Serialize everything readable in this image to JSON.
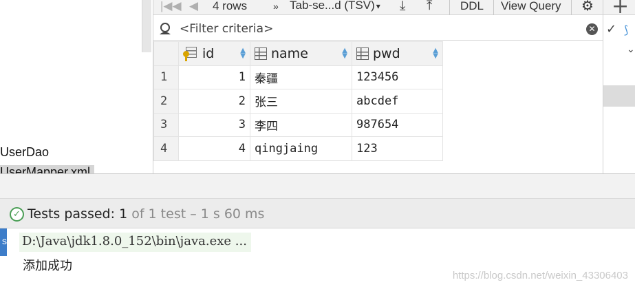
{
  "project_tree": {
    "item1": "UserDao",
    "item2": "UserMapper.xml"
  },
  "toolbar": {
    "rows_label": "4 rows",
    "format_label": "Tab-se...d (TSV)",
    "ddl_label": "DDL",
    "view_query_label": "View Query"
  },
  "filter": {
    "placeholder": "<Filter criteria>",
    "value": ""
  },
  "table": {
    "columns": [
      "id",
      "name",
      "pwd"
    ],
    "rows": [
      {
        "num": "1",
        "id": "1",
        "name": "秦疆",
        "pwd": "123456"
      },
      {
        "num": "2",
        "id": "2",
        "name": "张三",
        "pwd": "abcdef"
      },
      {
        "num": "3",
        "id": "3",
        "name": "李四",
        "pwd": "987654"
      },
      {
        "num": "4",
        "id": "4",
        "name": "qingjaing",
        "pwd": "123"
      }
    ]
  },
  "run_status": {
    "passed_label": "Tests passed:",
    "count": "1",
    "detail": "of 1 test – 1 s 60 ms"
  },
  "console": {
    "command": "D:\\Java\\jdk1.8.0_152\\bin\\java.exe ...",
    "output": "添加成功",
    "gutter": "s"
  },
  "watermark": "https://blog.csdn.net/weixin_43306403",
  "colors": {
    "accent_blue": "#3d7dc9",
    "pass_green": "#4a9e55",
    "key_gold": "#d9a400"
  },
  "icons": [
    "search-icon",
    "clear-icon",
    "plus-icon",
    "settings-icon",
    "check-icon",
    "chevron-down-icon",
    "primary-key-icon",
    "column-icon",
    "sort-icon",
    "test-passed-icon"
  ]
}
